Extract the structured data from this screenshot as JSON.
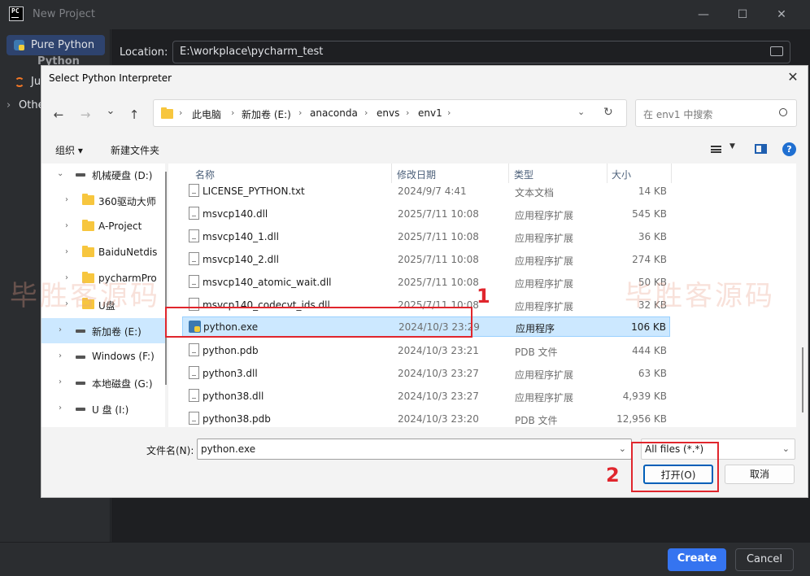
{
  "pycharm": {
    "logo_text": "PC",
    "title": "New Project",
    "sidebar": {
      "items": [
        {
          "label": "Pure Python",
          "selected": true
        },
        {
          "label": "Python"
        },
        {
          "label": "Ju"
        },
        {
          "label": "Othe"
        }
      ]
    },
    "location": {
      "label": "Location:",
      "value": "E:\\workplace\\pycharm_test"
    },
    "buttons": {
      "create": "Create",
      "cancel": "Cancel"
    },
    "colors": {
      "accent": "#3574f0",
      "bg": "#2b2d30"
    }
  },
  "dialog": {
    "title": "Select Python Interpreter",
    "close": "✕",
    "nav": {
      "back": "←",
      "forward": "→",
      "down": "⌄",
      "up": "↑",
      "refresh": "↻"
    },
    "breadcrumb": [
      "此电脑",
      "新加卷 (E:)",
      "anaconda",
      "envs",
      "env1"
    ],
    "search_placeholder": "在 env1 中搜索",
    "toolbar": {
      "organize": "组织 ▾",
      "new_folder": "新建文件夹"
    },
    "tree": [
      {
        "label": "机械硬盘 (D:)",
        "type": "drive",
        "expanded": true
      },
      {
        "label": "360驱动大师",
        "type": "folder"
      },
      {
        "label": "A-Project",
        "type": "folder"
      },
      {
        "label": "BaiduNetdis",
        "type": "folder"
      },
      {
        "label": "pycharmPro",
        "type": "folder"
      },
      {
        "label": "U盘",
        "type": "folder"
      },
      {
        "label": "新加卷 (E:)",
        "type": "drive",
        "selected": true
      },
      {
        "label": "Windows (F:)",
        "type": "drive"
      },
      {
        "label": "本地磁盘 (G:)",
        "type": "drive"
      },
      {
        "label": "U 盘 (I:)",
        "type": "drive"
      }
    ],
    "columns": {
      "name": "名称",
      "modified": "修改日期",
      "type": "类型",
      "size": "大小"
    },
    "files": [
      {
        "name": "LICENSE_PYTHON.txt",
        "modified": "2024/9/7 4:41",
        "type": "文本文档",
        "size": "14 KB"
      },
      {
        "name": "msvcp140.dll",
        "modified": "2025/7/11 10:08",
        "type": "应用程序扩展",
        "size": "545 KB"
      },
      {
        "name": "msvcp140_1.dll",
        "modified": "2025/7/11 10:08",
        "type": "应用程序扩展",
        "size": "36 KB"
      },
      {
        "name": "msvcp140_2.dll",
        "modified": "2025/7/11 10:08",
        "type": "应用程序扩展",
        "size": "274 KB"
      },
      {
        "name": "msvcp140_atomic_wait.dll",
        "modified": "2025/7/11 10:08",
        "type": "应用程序扩展",
        "size": "50 KB"
      },
      {
        "name": "msvcp140_codecvt_ids.dll",
        "modified": "2025/7/11 10:08",
        "type": "应用程序扩展",
        "size": "32 KB"
      },
      {
        "name": "python.exe",
        "modified": "2024/10/3 23:29",
        "type": "应用程序",
        "size": "106 KB",
        "selected": true
      },
      {
        "name": "python.pdb",
        "modified": "2024/10/3 23:21",
        "type": "PDB 文件",
        "size": "444 KB"
      },
      {
        "name": "python3.dll",
        "modified": "2024/10/3 23:27",
        "type": "应用程序扩展",
        "size": "63 KB"
      },
      {
        "name": "python38.dll",
        "modified": "2024/10/3 23:27",
        "type": "应用程序扩展",
        "size": "4,939 KB"
      },
      {
        "name": "python38.pdb",
        "modified": "2024/10/3 23:20",
        "type": "PDB 文件",
        "size": "12,956 KB"
      }
    ],
    "filename": {
      "label": "文件名(N):",
      "value": "python.exe"
    },
    "filetype": "All files (*.*)",
    "buttons": {
      "open": "打开(O)",
      "cancel": "取消"
    }
  },
  "annotations": {
    "step1": "1",
    "step2": "2"
  },
  "watermark": "毕胜客源码"
}
